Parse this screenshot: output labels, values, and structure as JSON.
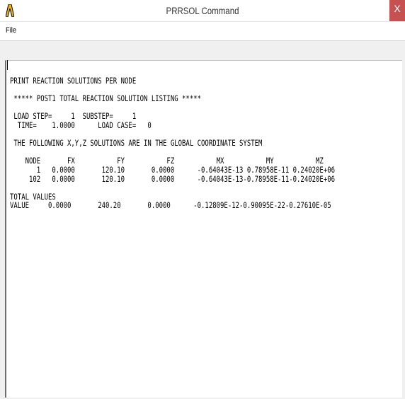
{
  "window": {
    "title": "PRRSOL  Command",
    "close_label": "X",
    "app_icon": "ansys-logo-icon"
  },
  "menu": {
    "file_label": "File"
  },
  "output": {
    "text": "PRINT REACTION SOLUTIONS PER NODE\n\n ***** POST1 TOTAL REACTION SOLUTION LISTING *****\n\n LOAD STEP=     1  SUBSTEP=     1\n  TIME=    1.0000      LOAD CASE=   0\n\n THE FOLLOWING X,Y,Z SOLUTIONS ARE IN THE GLOBAL COORDINATE SYSTEM\n\n    NODE       FX           FY           FZ           MX           MY           MZ\n       1   0.0000       120.10       0.0000      -0.64043E-13 0.78958E-11 0.24020E+06\n     102   0.0000       120.10       0.0000      -0.64043E-13-0.78958E-11-0.24020E+06\n\nTOTAL VALUES\nVALUE     0.0000       240.20       0.0000      -0.12809E-12-0.90095E-22-0.27610E-05"
  }
}
